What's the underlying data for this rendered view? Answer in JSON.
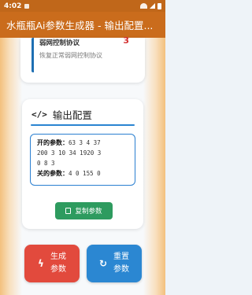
{
  "status_bar": {
    "time": "4:02"
  },
  "app_bar": {
    "title": "水瓶瓶Ai参数生成器 - 输出配置..."
  },
  "protocol_item": {
    "name": "弱网控制协议",
    "number": "3",
    "description": "恢复正常弱网控制协议"
  },
  "output_section": {
    "title": "输出配置",
    "on_label": "开的参数：",
    "on_values_line1": "63 3 4 37",
    "on_values_line2": "200 3 10 34 1920 3",
    "on_values_line3": "0 8 3",
    "off_label": "关的参数：",
    "off_values": "4 0 155 0",
    "copy_button": "复制参数"
  },
  "actions": {
    "generate_line1": "生成",
    "generate_line2": "参数",
    "reset_line1": "重置",
    "reset_line2": "参数"
  },
  "colors": {
    "app_bar": "#ca6c1c",
    "accent_blue": "#2a84d1",
    "generate": "#e24a3d",
    "reset": "#2b87d2",
    "copy": "#2e9b5f",
    "badge_red": "#d32f2f"
  },
  "icons": {
    "output": "code-icon",
    "copy": "clipboard-icon",
    "generate": "lightning-icon",
    "reset": "refresh-icon"
  }
}
